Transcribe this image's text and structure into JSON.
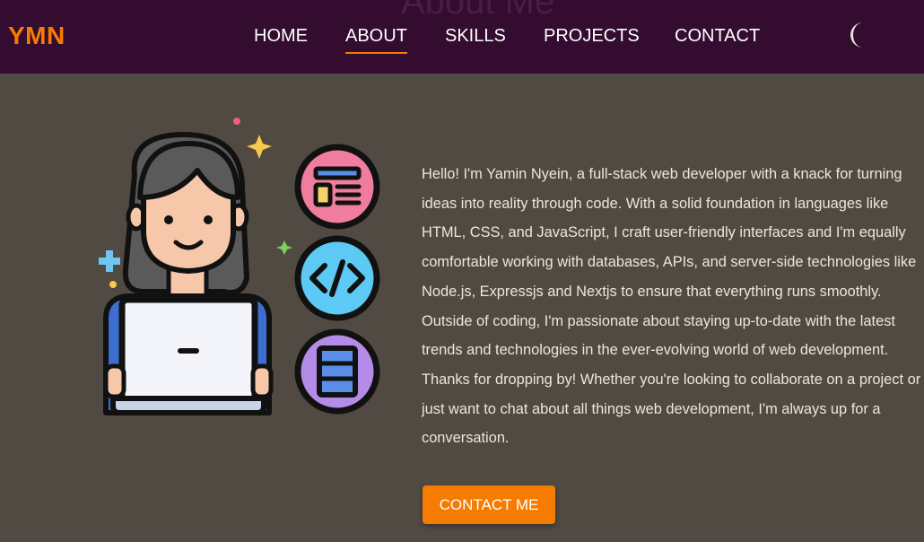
{
  "header": {
    "ghost_title": "About Me",
    "logo": "YMN",
    "nav": [
      {
        "label": "HOME",
        "active": false
      },
      {
        "label": "ABOUT",
        "active": true
      },
      {
        "label": "SKILLS",
        "active": false
      },
      {
        "label": "PROJECTS",
        "active": false
      },
      {
        "label": "CONTACT",
        "active": false
      }
    ],
    "theme_icon": "moon-icon"
  },
  "about": {
    "illustration": "developer-with-laptop-illustration",
    "icons": [
      "layout-icon",
      "code-icon",
      "database-icon"
    ],
    "bio": "Hello! I'm Yamin Nyein, a full-stack web developer with a knack for turning ideas into reality through code. With a solid foundation in languages like HTML, CSS, and JavaScript, I craft user-friendly interfaces and I'm equally comfortable working with databases, APIs, and server-side technologies like Node.js, Expressjs and Nextjs to ensure that everything runs smoothly. Outside of coding, I'm passionate about staying up-to-date with the latest trends and technologies in the ever-evolving world of web development. Thanks for dropping by! Whether you're looking to collaborate on a project or just want to chat about all things web development, I'm always up for a conversation.",
    "cta_label": "CONTACT ME"
  },
  "colors": {
    "navbar_bg": "#330c30",
    "page_bg": "#504a42",
    "accent": "#f57c00",
    "text": "#ece6dc"
  }
}
